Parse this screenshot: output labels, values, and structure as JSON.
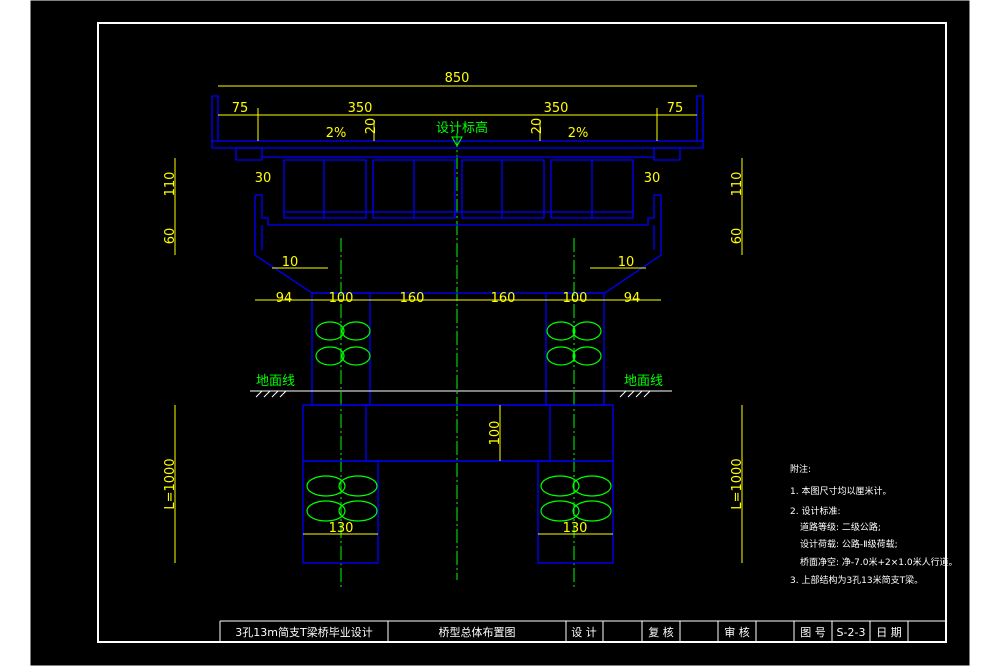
{
  "dims": {
    "total_width": "850",
    "left_edge": "75",
    "left_half": "350",
    "right_half": "350",
    "right_edge": "75",
    "slope_left": "2%",
    "slope_right": "2%",
    "thick_left": "20",
    "thick_right": "20",
    "center_mark": "设计标高",
    "h110_left": "110",
    "h110_right": "110",
    "h60_left": "60",
    "h60_right": "60",
    "w30_left": "30",
    "w30_right": "30",
    "w10_left": "10",
    "w10_right": "10",
    "cap_94_left": "94",
    "cap_100_left": "100",
    "cap_160_left": "160",
    "cap_160_right": "160",
    "cap_100_right": "100",
    "cap_94_right": "94",
    "beam_100": "100",
    "pile_len_left": "L=1000",
    "pile_len_right": "L=1000",
    "pile_dia_left": "130",
    "pile_dia_right": "130"
  },
  "labels": {
    "ground_left": "地面线",
    "ground_right": "地面线"
  },
  "notes": {
    "heading": "附注:",
    "items": [
      "1. 本图尺寸均以厘米计。",
      "2. 设计标准:",
      "道路等级: 二级公路;",
      "设计荷载: 公路-Ⅱ级荷载;",
      "桥面净空: 净-7.0米+2×1.0米人行道。",
      "3. 上部结构为3孔13米简支T梁。"
    ]
  },
  "title_block": {
    "project": "3孔13m简支T梁桥毕业设计",
    "drawing": "桥型总体布置图",
    "design_label": "设 计",
    "review_label": "复 核",
    "audit_label": "审 核",
    "fig_no_label": "图 号",
    "fig_no": "S-2-3",
    "date_label": "日 期"
  },
  "colors": {
    "background": "#000000",
    "frame": "#ffffff",
    "structure": "#0000ff",
    "dimension": "#ffff00",
    "centerline": "#00ff00"
  }
}
